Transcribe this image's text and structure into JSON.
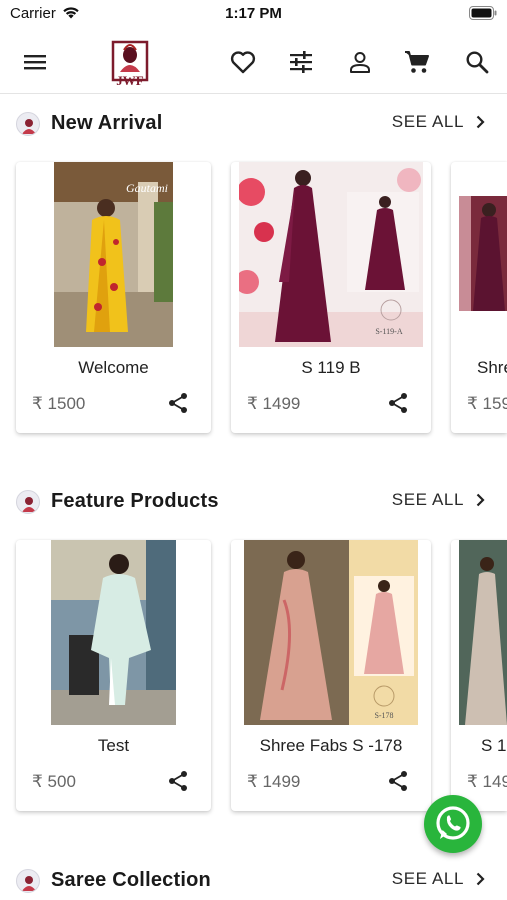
{
  "status_bar": {
    "carrier": "Carrier",
    "time": "1:17 PM"
  },
  "header": {
    "icons": [
      "menu-icon",
      "heart-icon",
      "filter-icon",
      "user-icon",
      "cart-icon",
      "search-icon"
    ],
    "logo_text": "JWF"
  },
  "sections": [
    {
      "title": "New Arrival",
      "see_all": "SEE ALL",
      "products": [
        {
          "name": "Welcome",
          "price": "₹ 1500"
        },
        {
          "name": "S 119 B",
          "price": "₹ 1499"
        },
        {
          "name": "Shre",
          "price": "₹ 159"
        }
      ]
    },
    {
      "title": "Feature Products",
      "see_all": "SEE ALL",
      "products": [
        {
          "name": "Test",
          "price": "₹ 500"
        },
        {
          "name": "Shree Fabs S -178",
          "price": "₹ 1499"
        },
        {
          "name": "S 1",
          "price": "₹ 149"
        }
      ]
    },
    {
      "title": "Saree Collection",
      "see_all": "SEE ALL"
    }
  ],
  "colors": {
    "accent": "#2a2a2a",
    "whatsapp": "#29b53c",
    "price": "#666666"
  }
}
